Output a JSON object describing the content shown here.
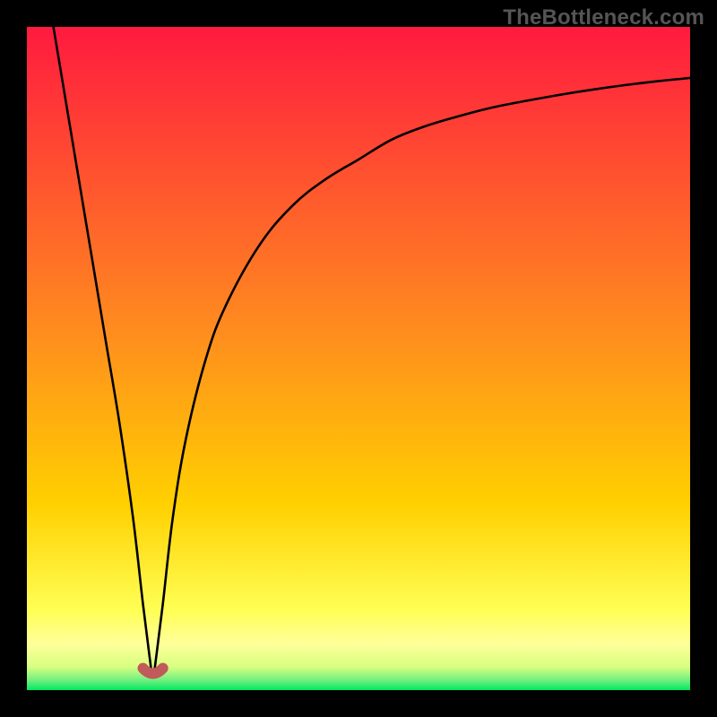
{
  "watermark": "TheBottleneck.com",
  "colors": {
    "frame": "#000000",
    "gradient_top": "#ff1a3f",
    "gradient_mid": "#ffd000",
    "gradient_yellowband": "#ffff8a",
    "gradient_bottom": "#00e861",
    "curve": "#000000",
    "marker": "#c15a5a"
  },
  "chart_data": {
    "type": "line",
    "title": "",
    "xlabel": "",
    "ylabel": "",
    "xlim": [
      0,
      1
    ],
    "ylim": [
      0,
      1
    ],
    "minimum_x": 0.19,
    "curve": {
      "x": [
        0.04,
        0.06,
        0.08,
        0.1,
        0.12,
        0.14,
        0.16,
        0.175,
        0.185,
        0.19,
        0.195,
        0.205,
        0.22,
        0.24,
        0.27,
        0.3,
        0.35,
        0.4,
        0.45,
        0.5,
        0.55,
        0.6,
        0.65,
        0.7,
        0.75,
        0.8,
        0.85,
        0.9,
        0.95,
        1.0
      ],
      "y_norm": [
        1.0,
        0.88,
        0.76,
        0.64,
        0.52,
        0.4,
        0.26,
        0.13,
        0.05,
        0.02,
        0.05,
        0.13,
        0.26,
        0.38,
        0.5,
        0.58,
        0.67,
        0.73,
        0.77,
        0.8,
        0.83,
        0.85,
        0.865,
        0.878,
        0.888,
        0.897,
        0.905,
        0.912,
        0.918,
        0.923
      ]
    },
    "marker": {
      "x": [
        0.175,
        0.19,
        0.205
      ],
      "y_norm": [
        0.033,
        0.025,
        0.033
      ],
      "shape": "u"
    },
    "note": "y_norm is fraction of plot height measured from the bottom; curve minimum touches the green band near x≈0.19."
  }
}
